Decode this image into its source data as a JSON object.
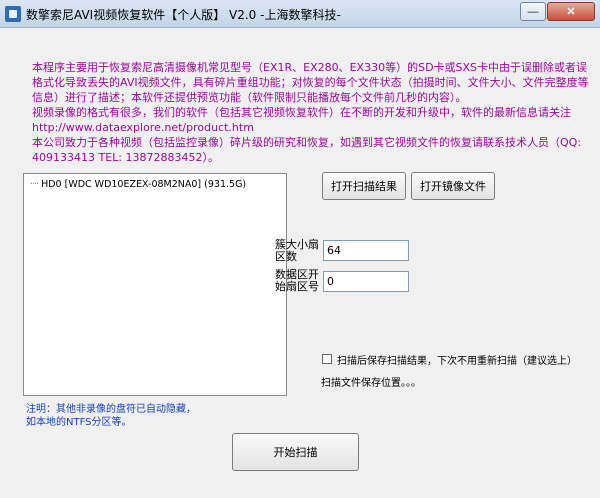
{
  "window": {
    "title": "数擎索尼AVI视频恢复软件【个人版】 V2.0  -上海数擎科技-",
    "minimize_label": "—",
    "close_label": "✕"
  },
  "intro": {
    "paragraph1": "本程序主要用于恢复索尼高清摄像机常见型号（EX1R、EX280、EX330等）的SD卡或SXS卡中由于误删除或者误格式化导致丢失的AVI视频文件，具有碎片重组功能；对恢复的每个文件状态（拍摄时间、文件大小、文件完整度等信息）进行了描述；本软件还提供预览功能（软件限制只能播放每个文件前几秒的内容）。",
    "paragraph2": "视频录像的格式有很多，我们的软件（包括其它视频恢复软件）在不断的开发和升级中，软件的最新信息请关注 http://www.dataexplore.net/product.htm",
    "paragraph3": "本公司致力于各种视频（包括监控录像）碎片级的研究和恢复，如遇到其它视频文件的恢复请联系技术人员（QQ: 409133413 TEL: 13872883452）。"
  },
  "drives": [
    {
      "label": "HD0  [WDC WD10EZEX-08M2NA0]  (931.5G)"
    }
  ],
  "buttons": {
    "open_scan": "打开扫描结果",
    "open_image": "打开镜像文件",
    "start_scan": "开始扫描"
  },
  "fields": {
    "max_sectors_label": "簇大小扇区数",
    "max_sectors_value": "64",
    "start_sector_label": "数据区开始扇区号",
    "start_sector_value": "0"
  },
  "options": {
    "save_checkbox_label": "扫描后保存扫描结果，下次不用重新扫描（建议选上）",
    "save_checked": false,
    "save_location_text": "扫描文件保存位置。。。"
  },
  "note": {
    "line1": "注明：其他非录像的盘符已自动隐藏，",
    "line2": "如本地的NTFS分区等。"
  }
}
